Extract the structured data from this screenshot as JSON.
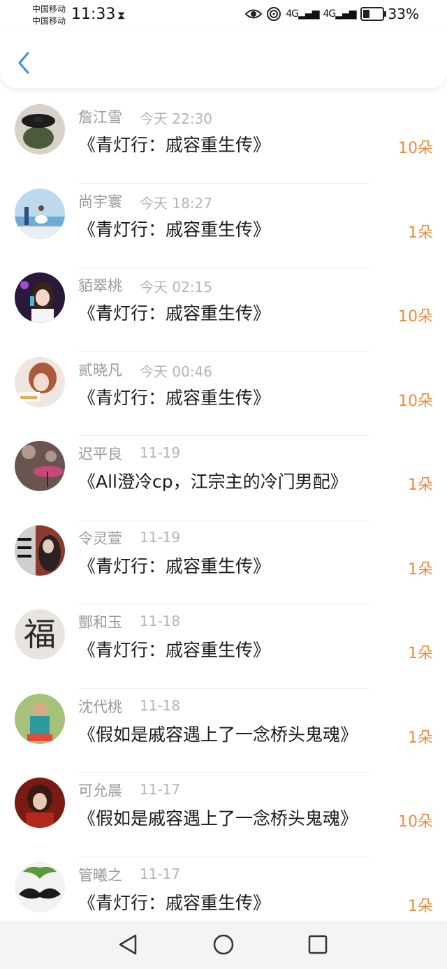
{
  "status_bar": {
    "carrier_1": "中国移动",
    "carrier_2": "中国移动",
    "time": "11:33",
    "hourglass_icon": "hourglass-icon",
    "net_1": "4G",
    "net_2": "4G",
    "battery": "33%"
  },
  "header": {
    "back_icon": "chevron-left-icon",
    "accent": "#3a8ee6"
  },
  "colors": {
    "count": "#f08a3c",
    "name": "#9a9a9a",
    "time": "#b5b5b5"
  },
  "rows": [
    {
      "name": "詹江雪",
      "time": "今天 22:30",
      "title": "《青灯行：戚容重生传》",
      "count": "10朵"
    },
    {
      "name": "尚宇寰",
      "time": "今天 18:27",
      "title": "《青灯行：戚容重生传》",
      "count": "1朵"
    },
    {
      "name": "貊翠桃",
      "time": "今天 02:15",
      "title": "《青灯行：戚容重生传》",
      "count": "10朵"
    },
    {
      "name": "贰晓凡",
      "time": "今天 00:46",
      "title": "《青灯行：戚容重生传》",
      "count": "10朵"
    },
    {
      "name": "迟平良",
      "time": "11-19",
      "title": "《All澄冷cp，江宗主的冷门男配》",
      "count": "1朵"
    },
    {
      "name": "令灵萱",
      "time": "11-19",
      "title": "《青灯行：戚容重生传》",
      "count": "1朵"
    },
    {
      "name": "酆和玉",
      "time": "11-18",
      "title": "《青灯行：戚容重生传》",
      "count": "1朵"
    },
    {
      "name": "沈代桃",
      "time": "11-18",
      "title": "《假如是戚容遇上了一念桥头鬼魂》",
      "count": "1朵"
    },
    {
      "name": "可允晨",
      "time": "11-17",
      "title": "《假如是戚容遇上了一念桥头鬼魂》",
      "count": "10朵"
    },
    {
      "name": "管曦之",
      "time": "11-17",
      "title": "《青灯行：戚容重生传》",
      "count": "1朵"
    }
  ],
  "avatar_7_glyph": "福",
  "navbar": {
    "back": "triangle-back-icon",
    "home": "circle-home-icon",
    "recents": "square-recents-icon"
  }
}
